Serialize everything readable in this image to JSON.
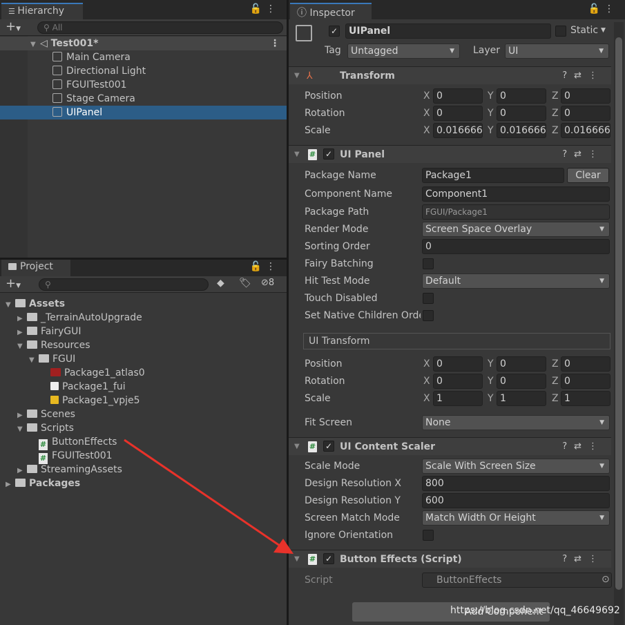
{
  "hierarchy": {
    "tab": "Hierarchy",
    "search_placeholder": "All",
    "scene": "Test001*",
    "items": [
      "Main Camera",
      "Directional Light",
      "FGUITest001",
      "Stage Camera",
      "UIPanel"
    ],
    "selected": "UIPanel"
  },
  "project": {
    "tab": "Project",
    "hidden_count": "8",
    "tree": [
      {
        "label": "Assets",
        "depth": 0,
        "type": "folder-open",
        "bold": true
      },
      {
        "label": "_TerrainAutoUpgrade",
        "depth": 1,
        "type": "folder"
      },
      {
        "label": "FairyGUI",
        "depth": 1,
        "type": "folder"
      },
      {
        "label": "Resources",
        "depth": 1,
        "type": "folder-open"
      },
      {
        "label": "FGUI",
        "depth": 2,
        "type": "folder-open"
      },
      {
        "label": "Package1_atlas0",
        "depth": 3,
        "type": "texture"
      },
      {
        "label": "Package1_fui",
        "depth": 3,
        "type": "file"
      },
      {
        "label": "Package1_vpje5",
        "depth": 3,
        "type": "audio"
      },
      {
        "label": "Scenes",
        "depth": 1,
        "type": "folder"
      },
      {
        "label": "Scripts",
        "depth": 1,
        "type": "folder-open"
      },
      {
        "label": "ButtonEffects",
        "depth": 2,
        "type": "script"
      },
      {
        "label": "FGUITest001",
        "depth": 2,
        "type": "script"
      },
      {
        "label": "StreamingAssets",
        "depth": 1,
        "type": "folder"
      },
      {
        "label": "Packages",
        "depth": 0,
        "type": "folder",
        "bold": true
      }
    ]
  },
  "inspector": {
    "tab": "Inspector",
    "object_name": "UIPanel",
    "static_label": "Static",
    "tag_label": "Tag",
    "tag_value": "Untagged",
    "layer_label": "Layer",
    "layer_value": "UI",
    "transform": {
      "title": "Transform",
      "rows": [
        {
          "label": "Position",
          "x": "0",
          "y": "0",
          "z": "0"
        },
        {
          "label": "Rotation",
          "x": "0",
          "y": "0",
          "z": "0"
        },
        {
          "label": "Scale",
          "x": "0.016666",
          "y": "0.016666",
          "z": "0.016666"
        }
      ]
    },
    "ui_panel": {
      "title": "UI Panel",
      "package_name_label": "Package Name",
      "package_name": "Package1",
      "clear": "Clear",
      "component_name_label": "Component Name",
      "component_name": "Component1",
      "package_path_label": "Package Path",
      "package_path": "FGUI/Package1",
      "render_mode_label": "Render Mode",
      "render_mode": "Screen Space Overlay",
      "sorting_order_label": "Sorting Order",
      "sorting_order": "0",
      "fairy_batching_label": "Fairy Batching",
      "hit_test_mode_label": "Hit Test Mode",
      "hit_test_mode": "Default",
      "touch_disabled_label": "Touch Disabled",
      "native_children_label": "Set Native Children Order",
      "ui_transform": "UI Transform",
      "rows": [
        {
          "label": "Position",
          "x": "0",
          "y": "0",
          "z": "0"
        },
        {
          "label": "Rotation",
          "x": "0",
          "y": "0",
          "z": "0"
        },
        {
          "label": "Scale",
          "x": "1",
          "y": "1",
          "z": "1"
        }
      ],
      "fit_screen_label": "Fit Screen",
      "fit_screen": "None"
    },
    "content_scaler": {
      "title": "UI Content Scaler",
      "scale_mode_label": "Scale Mode",
      "scale_mode": "Scale With Screen Size",
      "res_x_label": "Design Resolution X",
      "res_x": "800",
      "res_y_label": "Design Resolution Y",
      "res_y": "600",
      "match_label": "Screen Match Mode",
      "match": "Match Width Or Height",
      "ignore_label": "Ignore Orientation"
    },
    "button_effects": {
      "title": "Button Effects (Script)",
      "script_label": "Script",
      "script": "ButtonEffects"
    },
    "add_component": "Add Component"
  },
  "watermark": "https://blog.csdn.net/qq_46649692",
  "colors": {
    "selection": "#2c5d87",
    "accent": "#3a79bb",
    "arrow": "#e8322a"
  }
}
